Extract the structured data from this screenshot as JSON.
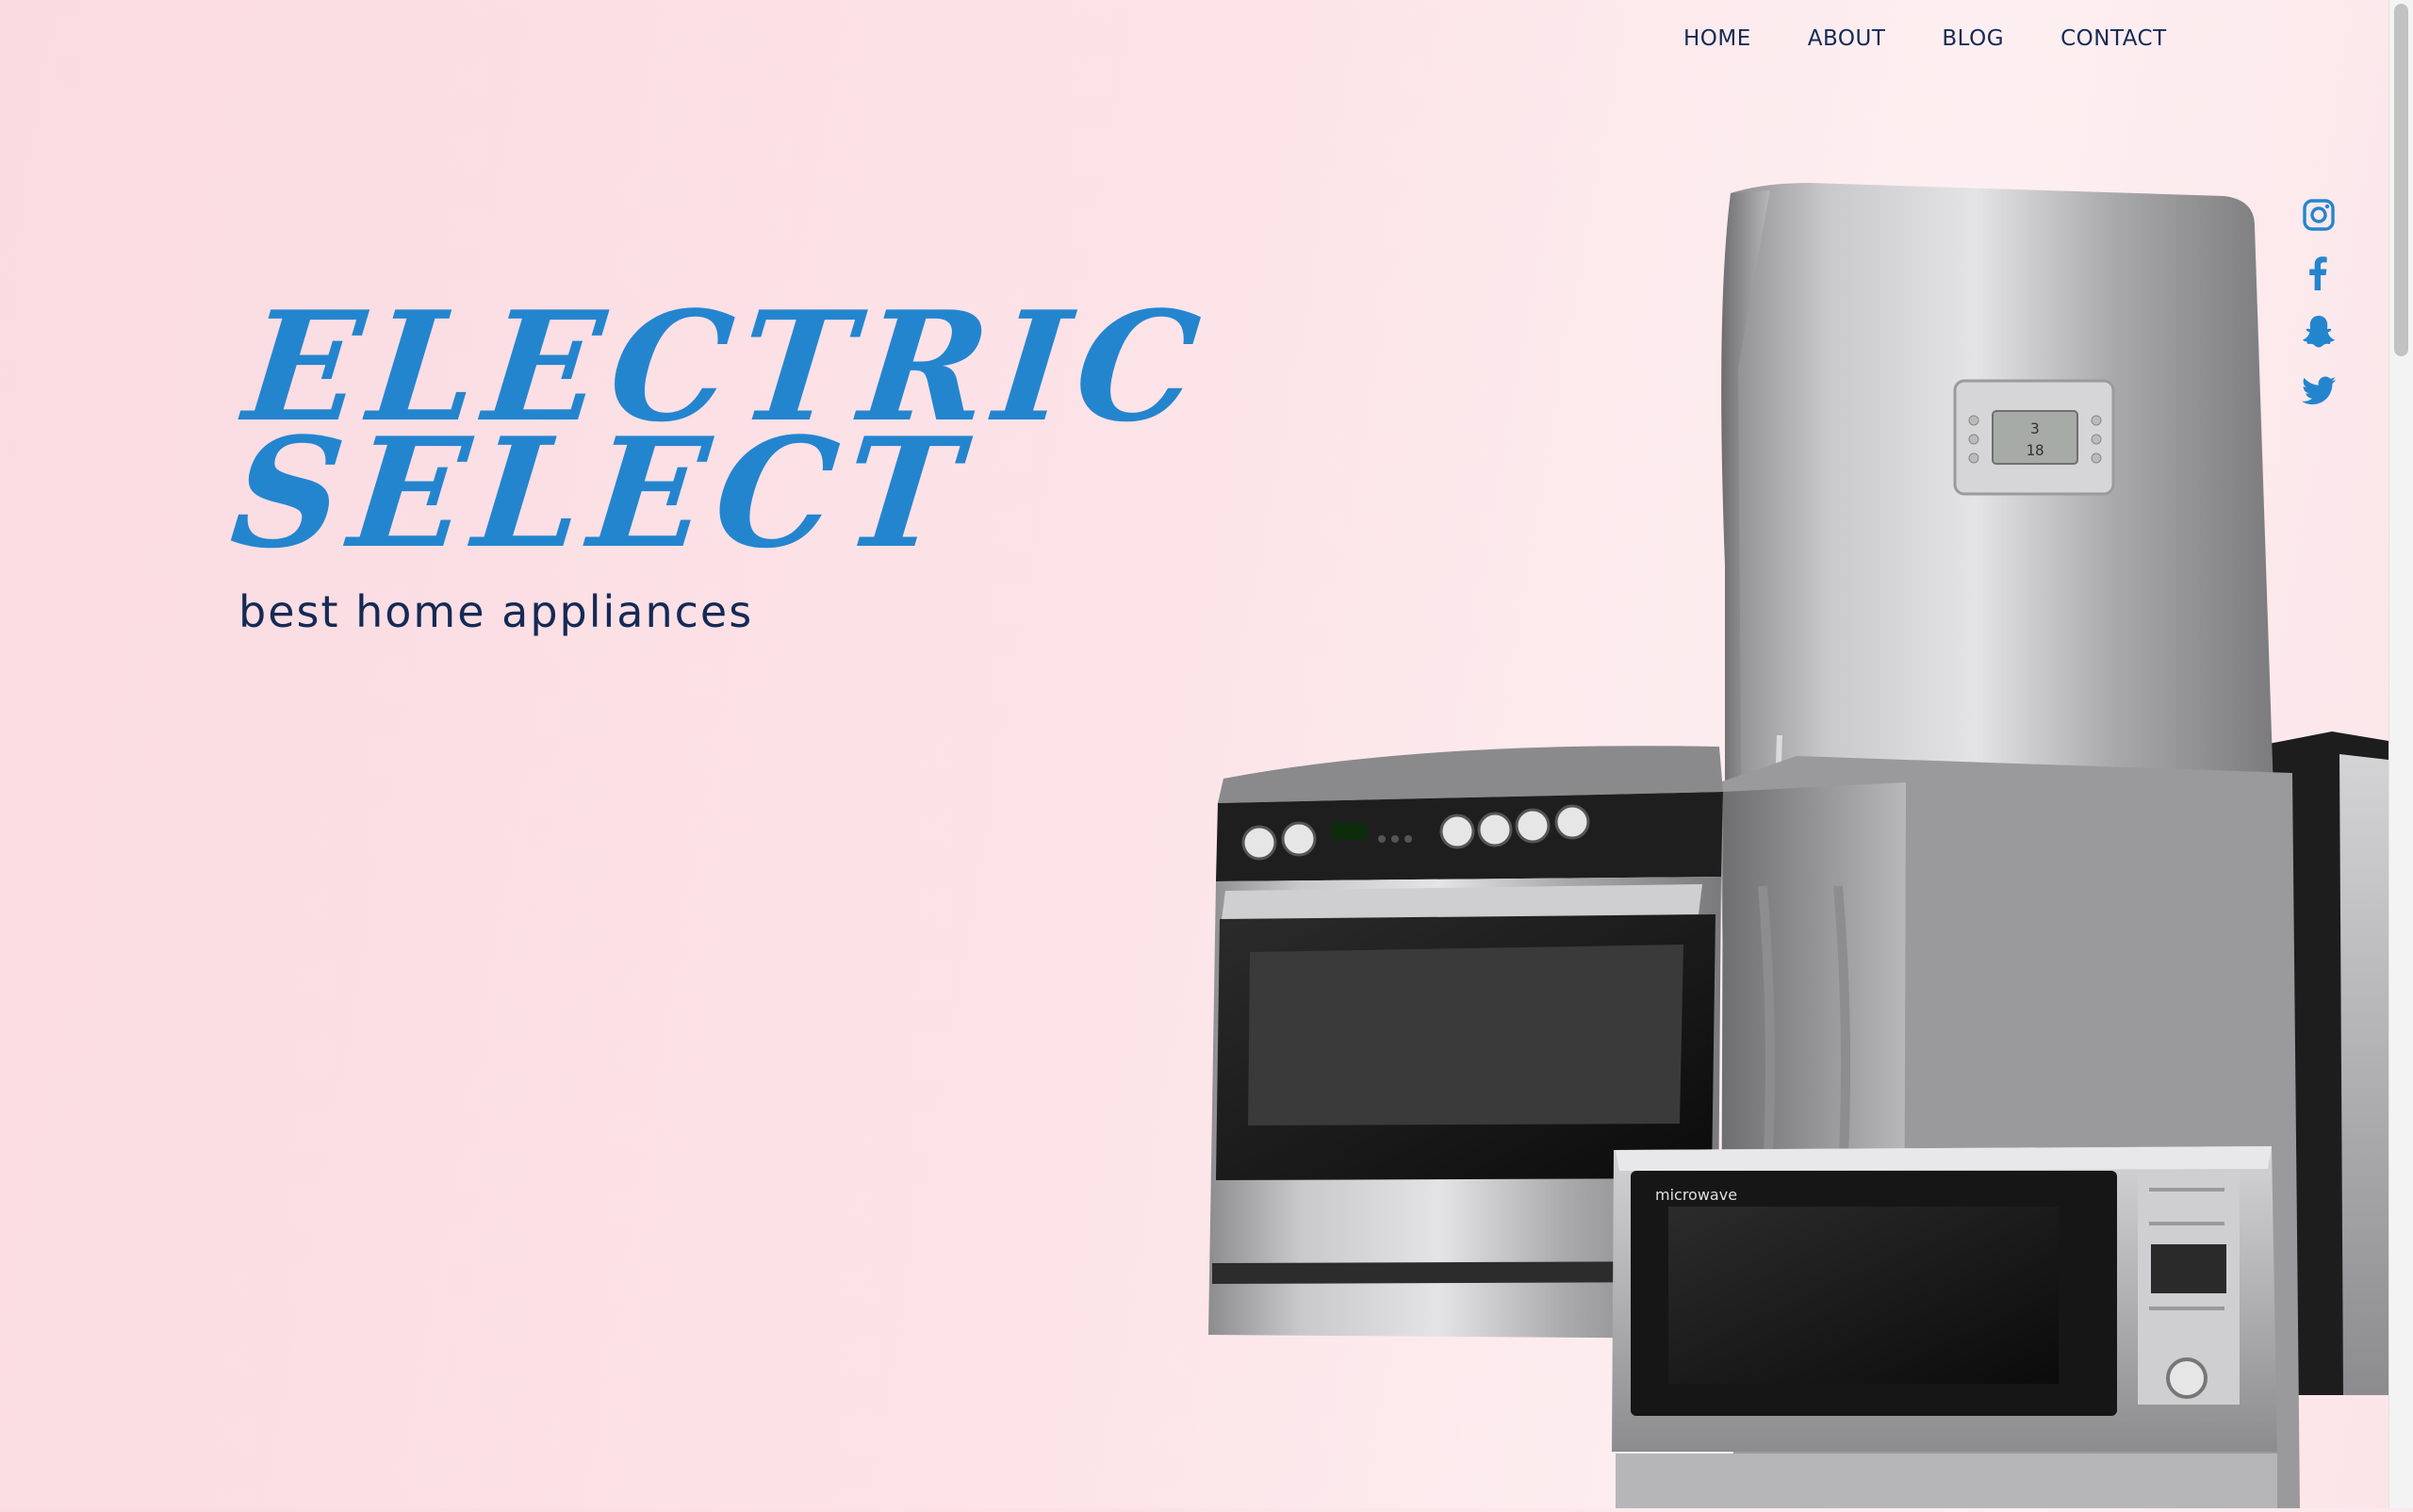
{
  "nav": {
    "items": [
      "HOME",
      "ABOUT",
      "BLOG",
      "CONTACT"
    ]
  },
  "hero": {
    "title_line1": "ELECTRIC",
    "title_line2": "SELECT",
    "subtitle": "best home appliances"
  },
  "social": [
    "instagram-icon",
    "facebook-icon",
    "snapchat-icon",
    "twitter-icon"
  ],
  "appliances": {
    "microwave_label": "microwave",
    "fridge_display_top": "3",
    "fridge_display_bottom": "18"
  },
  "colors": {
    "accent": "#2485cf",
    "nav_text": "#142a55",
    "background": "#fadbe1"
  }
}
